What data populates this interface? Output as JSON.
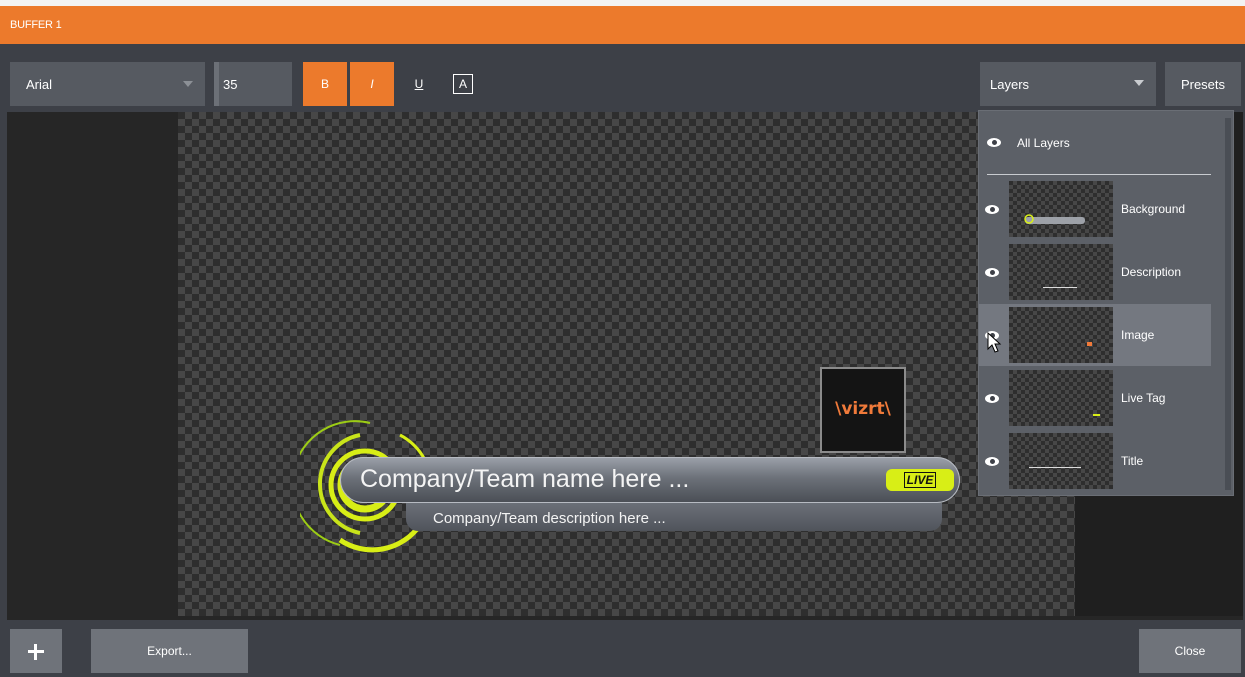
{
  "window": {
    "title": "BUFFER 1"
  },
  "toolbar": {
    "font": "Arial",
    "font_size": "35",
    "bold_label": "B",
    "italic_label": "I",
    "underline_label": "U",
    "text_color_label": "A",
    "layers_label": "Layers",
    "presets_label": "Presets"
  },
  "canvas": {
    "title_text": "Company/Team name here ...",
    "description_text": "Company/Team description here ...",
    "live_tag": "LIVE",
    "logo_text": "\\vizrt\\"
  },
  "layers": {
    "all_layers": "All Layers",
    "items": [
      {
        "label": "Background"
      },
      {
        "label": "Description"
      },
      {
        "label": "Image"
      },
      {
        "label": "Live Tag"
      },
      {
        "label": "Title"
      }
    ],
    "selected": "Image"
  },
  "footer": {
    "export_label": "Export...",
    "close_label": "Close"
  },
  "colors": {
    "accent": "#ec7a2c",
    "live": "#d8ee16",
    "logo": "#f07a3a"
  }
}
